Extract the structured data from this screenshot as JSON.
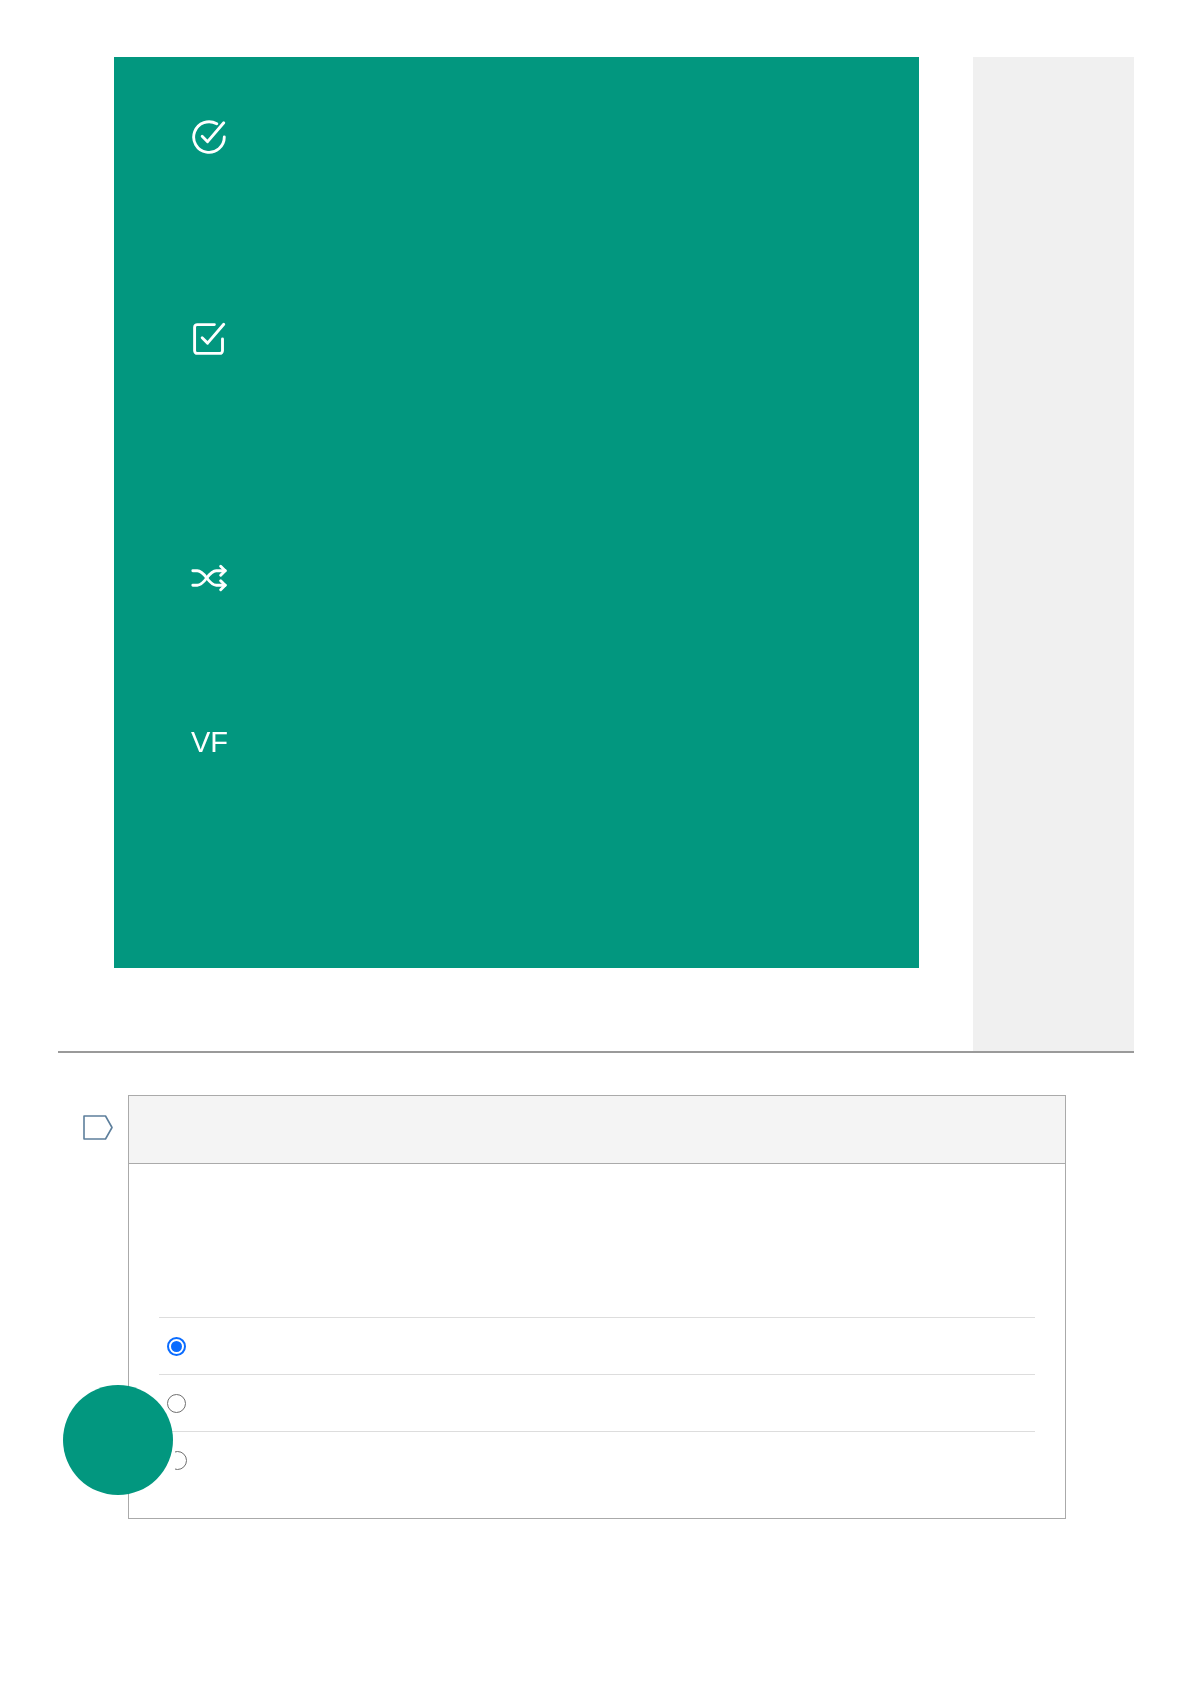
{
  "panel": {
    "label": "VF"
  },
  "question": {
    "options": [
      {
        "selected": true
      },
      {
        "selected": false
      },
      {
        "selected": false
      }
    ]
  }
}
